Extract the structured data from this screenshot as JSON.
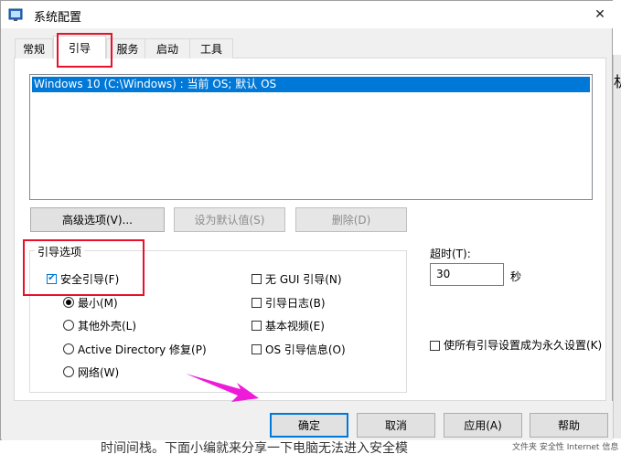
{
  "window": {
    "title": "系统配置"
  },
  "tabs": [
    {
      "label": "常规",
      "active": false
    },
    {
      "label": "引导",
      "active": true
    },
    {
      "label": "服务",
      "active": false
    },
    {
      "label": "启动",
      "active": false
    },
    {
      "label": "工具",
      "active": false
    }
  ],
  "boot_list": {
    "items": [
      "Windows 10 (C:\\Windows) : 当前 OS; 默认 OS"
    ],
    "selected_index": 0
  },
  "boot_actions": {
    "advanced": "高级选项(V)...",
    "set_default": "设为默认值(S)",
    "delete": "删除(D)"
  },
  "boot_options": {
    "group_label": "引导选项",
    "safe_boot": {
      "label": "安全引导(F)",
      "checked": true
    },
    "radios": [
      {
        "label": "最小(M)",
        "selected": true
      },
      {
        "label": "其他外壳(L)",
        "selected": false
      },
      {
        "label": "Active Directory 修复(P)",
        "selected": false
      },
      {
        "label": "网络(W)",
        "selected": false
      }
    ],
    "checkboxes": [
      {
        "label": "无 GUI 引导(N)",
        "checked": false
      },
      {
        "label": "引导日志(B)",
        "checked": false
      },
      {
        "label": "基本视频(E)",
        "checked": false
      },
      {
        "label": "OS 引导信息(O)",
        "checked": false
      }
    ]
  },
  "timeout": {
    "label": "超时(T):",
    "value": "30",
    "unit": "秒"
  },
  "permanent": {
    "label": "使所有引导设置成为永久设置(K)",
    "checked": false
  },
  "dialog_buttons": {
    "ok": "确定",
    "cancel": "取消",
    "apply": "应用(A)",
    "help": "帮助"
  },
  "background": {
    "right_glyph": "机",
    "bottom_text": "时间间栈。下面小编就来分享一下电脑无法进入安全模",
    "bottom_small": "文件夹  安全性  Internet 信息"
  },
  "colors": {
    "selection": "#0078d7",
    "annotation": "#e8102a",
    "arrow": "#ee1bd8"
  }
}
